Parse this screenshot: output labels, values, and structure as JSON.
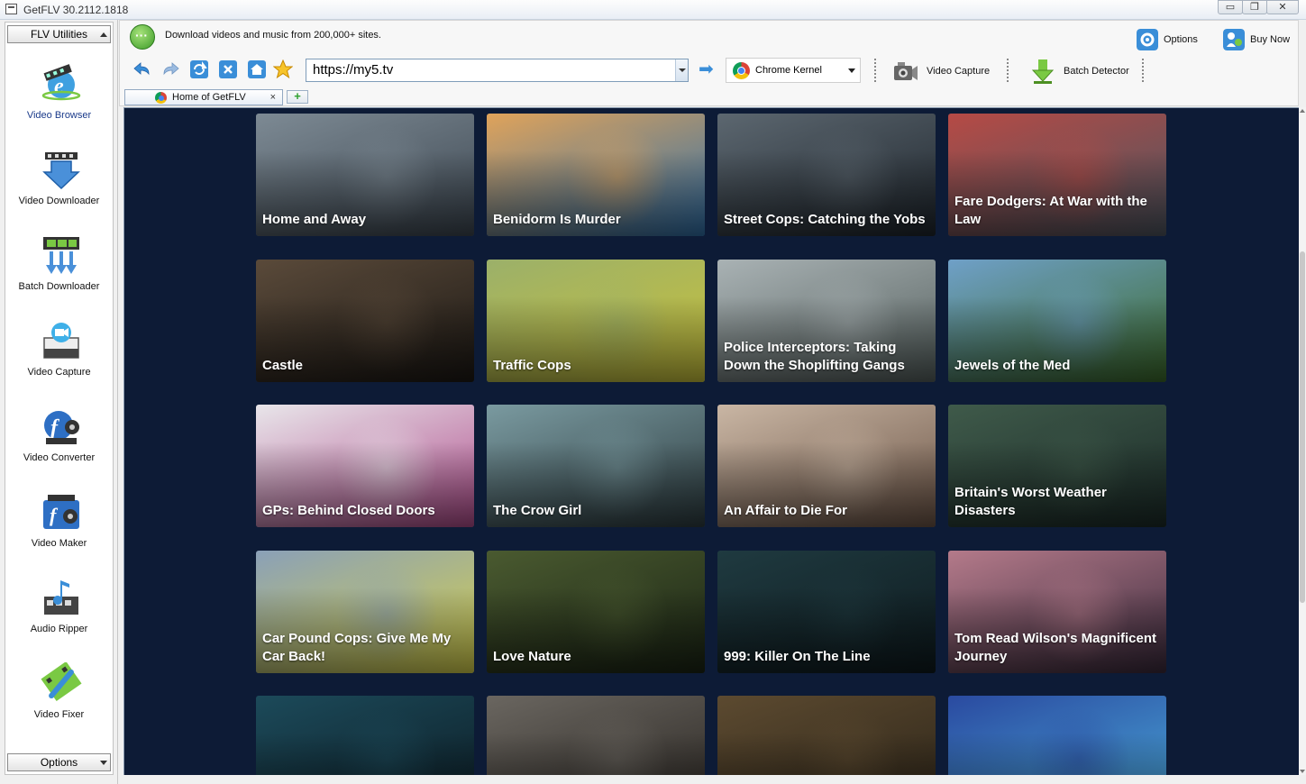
{
  "window": {
    "title": "GetFLV 30.2112.1818",
    "minimize": "▭",
    "restore": "❐",
    "close": "✕"
  },
  "sidebar": {
    "top_combo": "FLV Utilities",
    "bottom_combo": "Options",
    "tools": [
      {
        "label": "Video Browser",
        "icon": "video-browser-icon"
      },
      {
        "label": "Video Downloader",
        "icon": "video-downloader-icon"
      },
      {
        "label": "Batch Downloader",
        "icon": "batch-downloader-icon"
      },
      {
        "label": "Video Capture",
        "icon": "video-capture-icon"
      },
      {
        "label": "Video Converter",
        "icon": "video-converter-icon"
      },
      {
        "label": "Video Maker",
        "icon": "video-maker-icon"
      },
      {
        "label": "Audio Ripper",
        "icon": "audio-ripper-icon"
      },
      {
        "label": "Video Fixer",
        "icon": "video-fixer-icon"
      }
    ]
  },
  "toolbar": {
    "promo": "Download videos and music from 200,000+ sites.",
    "options_label": "Options",
    "buy_label": "Buy Now",
    "url": "https://my5.tv",
    "kernel": "Chrome Kernel",
    "video_capture": "Video Capture",
    "batch_detector": "Batch Detector"
  },
  "tabs": [
    {
      "label": "Home of GetFLV",
      "close": "×"
    }
  ],
  "new_tab": "+",
  "cards": [
    {
      "title": "Home and Away",
      "c1": "#7d8a94",
      "c2": "#3c4650"
    },
    {
      "title": "Benidorm Is Murder",
      "c1": "#e0a35a",
      "c2": "#2f6fa8"
    },
    {
      "title": "Street Cops: Catching the Yobs",
      "c1": "#5c6770",
      "c2": "#1e252c"
    },
    {
      "title": "Fare Dodgers: At War with the Law",
      "c1": "#b64a45",
      "c2": "#4c5560"
    },
    {
      "title": "Castle",
      "c1": "#5a4a3a",
      "c2": "#1c1814"
    },
    {
      "title": "Traffic Cops",
      "c1": "#9bb06a",
      "c2": "#c9c23a"
    },
    {
      "title": "Police Interceptors: Taking Down the Shoplifting Gangs",
      "c1": "#a9b2b4",
      "c2": "#55605e"
    },
    {
      "title": "Jewels of the Med",
      "c1": "#6fa0c8",
      "c2": "#3b6a2a"
    },
    {
      "title": "GPs: Behind Closed Doors",
      "c1": "#e8e6ea",
      "c2": "#b04c8c"
    },
    {
      "title": "The Crow Girl",
      "c1": "#7a9aa0",
      "c2": "#2d3c40"
    },
    {
      "title": "An Affair to Die For",
      "c1": "#c9b6a4",
      "c2": "#6b5446"
    },
    {
      "title": "Britain's Worst Weather Disasters",
      "c1": "#3f5a4a",
      "c2": "#1b2b28"
    },
    {
      "title": "Car Pound Cops: Give Me My Car Back!",
      "c1": "#8aa0b8",
      "c2": "#d7d24a"
    },
    {
      "title": "Love Nature",
      "c1": "#4a5a30",
      "c2": "#1a2414"
    },
    {
      "title": "999: Killer On The Line",
      "c1": "#1f3a40",
      "c2": "#0e1a1e"
    },
    {
      "title": "Tom Read Wilson's Magnificent Journey",
      "c1": "#b47a8a",
      "c2": "#3a2a3c"
    },
    {
      "title": "",
      "c1": "#1c4a5a",
      "c2": "#0c1c24"
    },
    {
      "title": "",
      "c1": "#6a6660",
      "c2": "#2a2622"
    },
    {
      "title": "",
      "c1": "#5c4a30",
      "c2": "#2c2418"
    },
    {
      "title": "",
      "c1": "#2a4aa0",
      "c2": "#4aa8d8"
    }
  ]
}
